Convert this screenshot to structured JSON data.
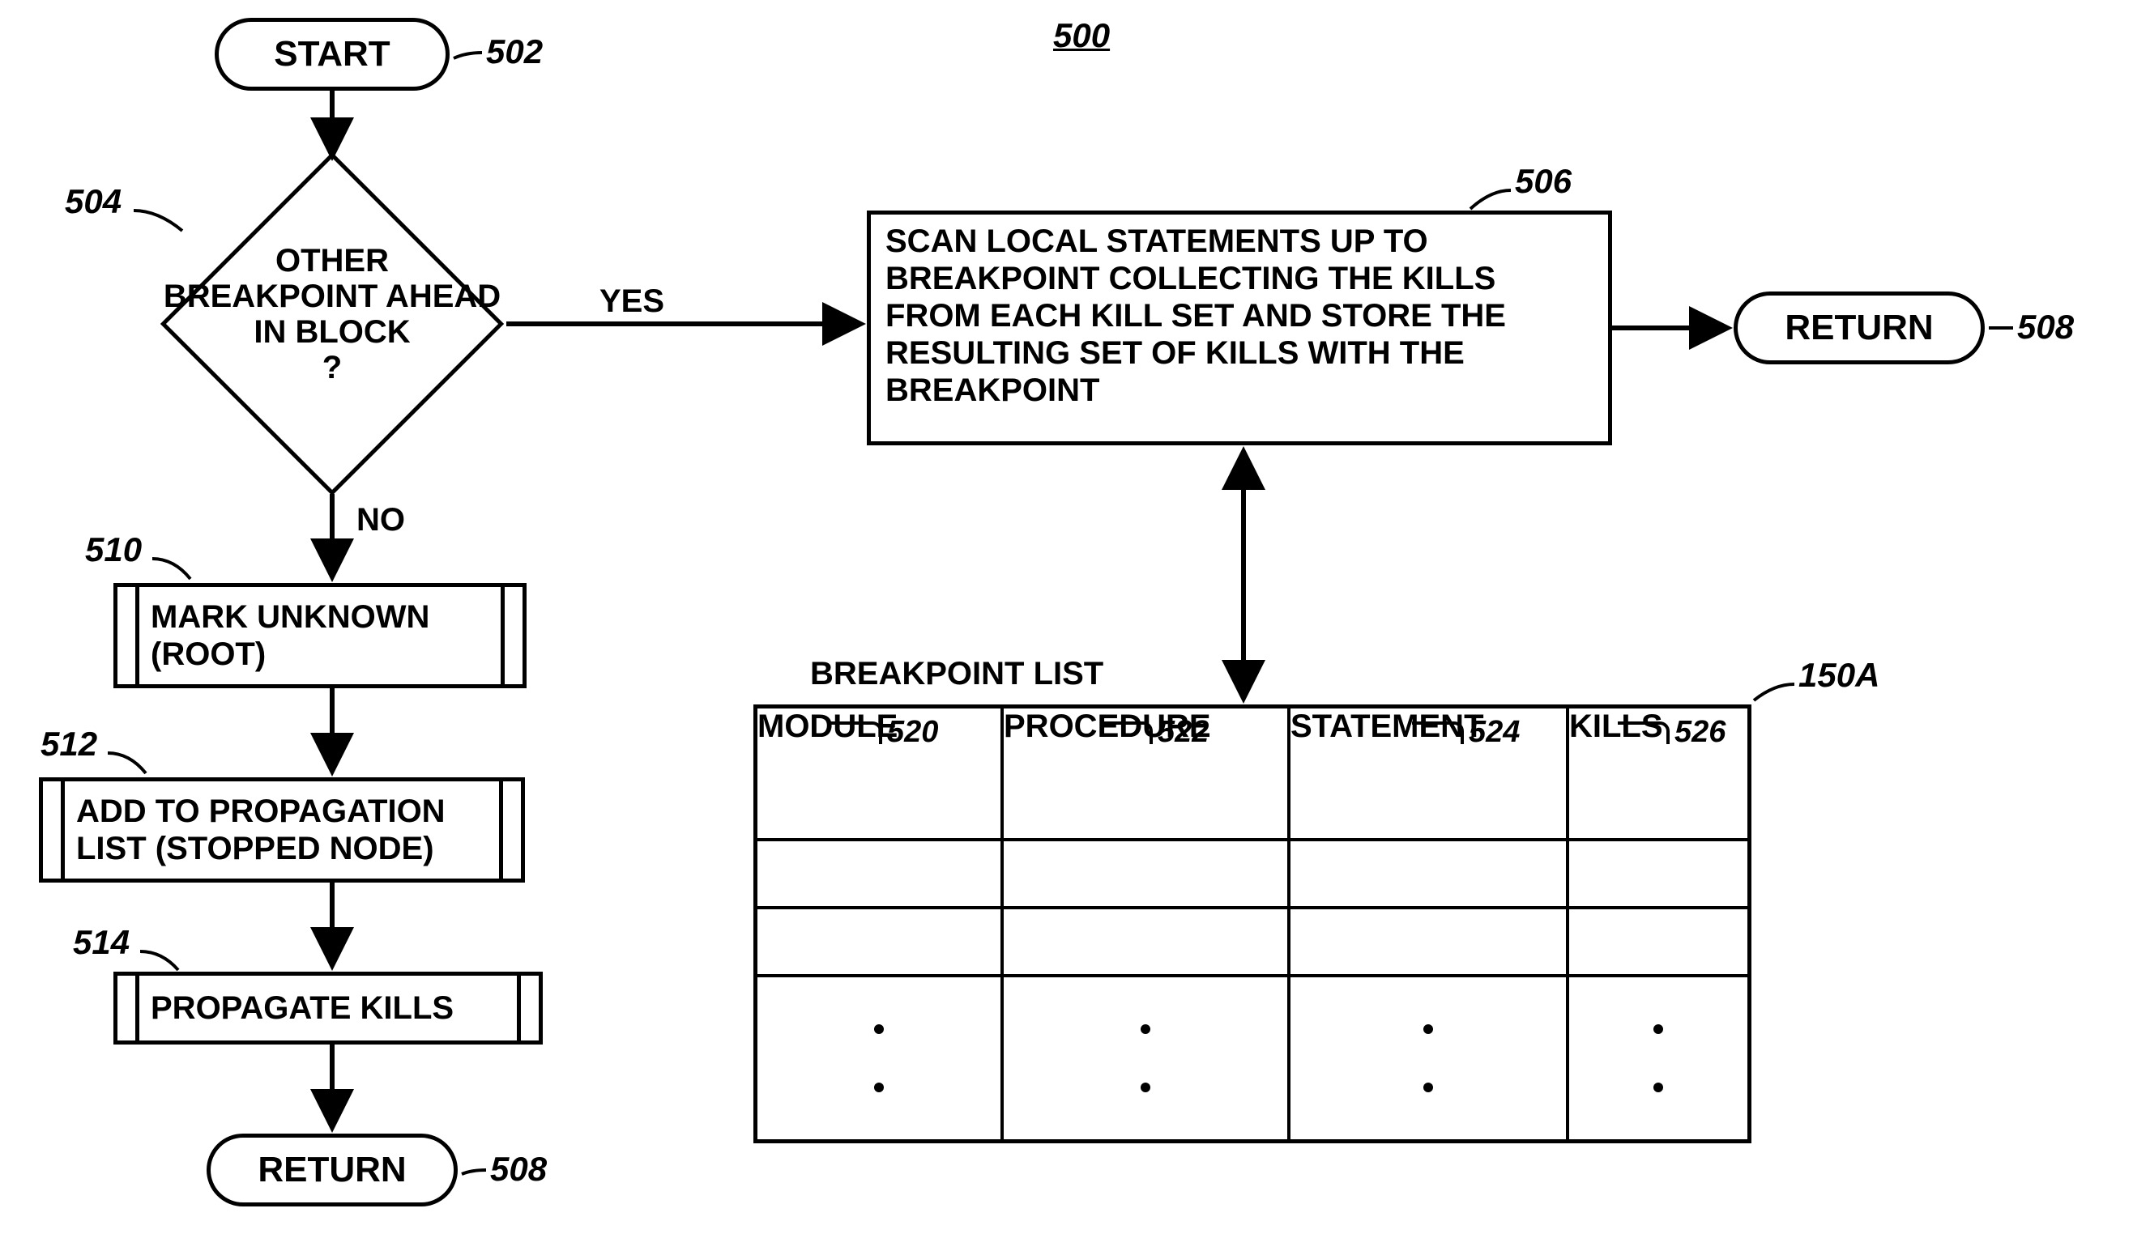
{
  "figure_ref": "500",
  "nodes": {
    "start": {
      "text": "START",
      "ref": "502"
    },
    "decision": {
      "text": "OTHER BREAKPOINT AHEAD IN BLOCK ?",
      "ref": "504",
      "yes": "YES",
      "no": "NO"
    },
    "scan": {
      "text": "SCAN LOCAL STATEMENTS UP TO BREAKPOINT COLLECTING THE KILLS FROM EACH KILL SET AND STORE THE RESULTING SET OF KILLS WITH THE BREAKPOINT",
      "ref": "506"
    },
    "return_top": {
      "text": "RETURN",
      "ref": "508"
    },
    "mark_unknown": {
      "text": "MARK UNKNOWN (ROOT)",
      "ref": "510"
    },
    "add_propagation": {
      "text": "ADD TO PROPAGATION LIST (STOPPED NODE)",
      "ref": "512"
    },
    "propagate": {
      "text": "PROPAGATE KILLS",
      "ref": "514"
    },
    "return_bottom": {
      "text": "RETURN",
      "ref_b": "508"
    }
  },
  "table": {
    "title": "BREAKPOINT LIST",
    "ref": "150A",
    "columns": [
      {
        "header": "MODULE",
        "ref": "520"
      },
      {
        "header": "PROCEDURE",
        "ref": "522"
      },
      {
        "header": "STATEMENT",
        "ref": "524"
      },
      {
        "header": "KILLS",
        "ref": "526"
      }
    ]
  }
}
